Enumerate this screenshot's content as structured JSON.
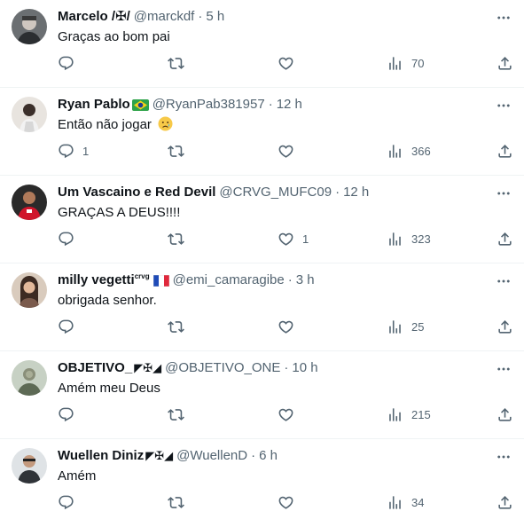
{
  "tweets": [
    {
      "name": "Marcelo /✠/",
      "handle": "@marckdf",
      "time": "5 h",
      "text": "Graças ao bom pai",
      "replies": "",
      "retweets": "",
      "likes": "",
      "views": "70"
    },
    {
      "name": "Ryan Pablo",
      "handle": "@RyanPab381957",
      "time": "12 h",
      "text": "Então não jogar",
      "replies": "1",
      "retweets": "",
      "likes": "",
      "views": "366",
      "name_emoji": "brazil-flag",
      "text_emoji": "crying-face"
    },
    {
      "name": "Um Vascaino e Red Devil",
      "handle": "@CRVG_MUFC09",
      "time": "12 h",
      "text": "GRAÇAS A DEUS!!!!",
      "replies": "",
      "retweets": "",
      "likes": "1",
      "views": "323"
    },
    {
      "name": "milly vegetti",
      "name_sup": "crvg",
      "handle": "@emi_camaragibe",
      "time": "3 h",
      "text": "obrigada senhor.",
      "replies": "",
      "retweets": "",
      "likes": "",
      "views": "25",
      "name_emoji": "france-flag"
    },
    {
      "name": "OBJETIVO_",
      "name_decor": "◤✠◢",
      "handle": "@OBJETIVO_ONE",
      "time": "10 h",
      "text": "Amém meu Deus",
      "replies": "",
      "retweets": "",
      "likes": "",
      "views": "215"
    },
    {
      "name": "Wuellen Diniz",
      "name_decor": "◤✠◢",
      "handle": "@WuellenD",
      "time": "6 h",
      "text": "Amém",
      "replies": "",
      "retweets": "",
      "likes": "",
      "views": "34"
    }
  ],
  "separator": "·",
  "icons": {
    "reply": "reply-icon",
    "retweet": "retweet-icon",
    "like": "heart-icon",
    "views": "views-icon",
    "share": "share-icon",
    "more": "more-icon"
  },
  "colors": {
    "text": "#0f1419",
    "secondary": "#536471",
    "border": "#eff3f4"
  }
}
